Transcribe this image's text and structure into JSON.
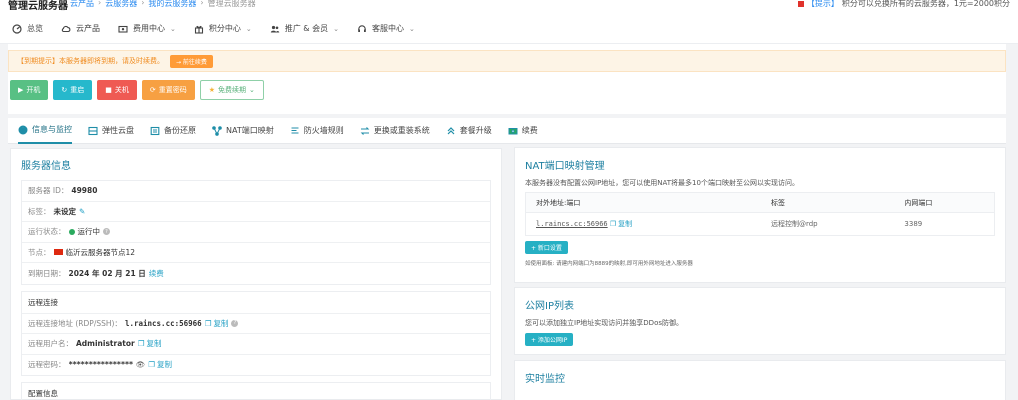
{
  "topbar": {
    "title": "管理云服务器",
    "breadcrumbs": [
      "云产品",
      "云服务器",
      "我的云服务器",
      "管理云服务器"
    ],
    "notice_prefix": "【提示】",
    "notice_text": "积分可以兑换所有的云服务器，1元=2000积分"
  },
  "nav": {
    "items": [
      {
        "label": "总览",
        "icon": "dashboard-icon",
        "chevron": false
      },
      {
        "label": "云产品",
        "icon": "cloud-icon",
        "chevron": false
      },
      {
        "label": "费用中心",
        "icon": "money-icon",
        "chevron": true
      },
      {
        "label": "积分中心",
        "icon": "gift-icon",
        "chevron": true
      },
      {
        "label": "推广 & 会员",
        "icon": "users-icon",
        "chevron": true
      },
      {
        "label": "客服中心",
        "icon": "headset-icon",
        "chevron": true
      }
    ]
  },
  "alert": {
    "text": "【到期提示】本服务器即将到期，请及时续费。",
    "renew_label": "→ 前往续费"
  },
  "actions": {
    "start": "开机",
    "restart": "重启",
    "shutdown": "关机",
    "reset_password": "重置密码",
    "free_renew": "免费续期"
  },
  "tabs": [
    {
      "label": "信息与监控",
      "icon": "info-icon",
      "active": true
    },
    {
      "label": "弹性云盘",
      "icon": "disk-icon",
      "active": false
    },
    {
      "label": "备份还原",
      "icon": "backup-icon",
      "active": false
    },
    {
      "label": "NAT端口映射",
      "icon": "network-icon",
      "active": false
    },
    {
      "label": "防火墙规则",
      "icon": "firewall-icon",
      "active": false
    },
    {
      "label": "更换或重装系统",
      "icon": "swap-icon",
      "active": false
    },
    {
      "label": "套餐升级",
      "icon": "upgrade-icon",
      "active": false
    },
    {
      "label": "续费",
      "icon": "renew-icon",
      "active": false
    }
  ],
  "server_info": {
    "title": "服务器信息",
    "id_label": "服务器 ID：",
    "id_value": "49980",
    "tag_label": "标签：",
    "tag_value": "未设定",
    "status_label": "运行状态：",
    "status_value": "运行中",
    "node_label": "节点：",
    "node_value": "临沂云服务器节点12",
    "expiry_label": "到期日期：",
    "expiry_value": "2024 年 02 月 21 日",
    "expiry_renew": "续费"
  },
  "remote": {
    "title": "远程连接",
    "addr_label": "远程连接地址 (RDP/SSH)：",
    "addr_value": "l.raincs.cc:56966",
    "user_label": "远程用户名：",
    "user_value": "Administrator",
    "pwd_label": "远程密码：",
    "pwd_value": "****************",
    "copy_label": "复制"
  },
  "config": {
    "title": "配置信息"
  },
  "nat": {
    "title": "NAT端口映射管理",
    "desc": "本服务器没有配置公网IP地址，您可以使用NAT将最多10个端口映射至公网以实现访问。",
    "headers": [
      "对外地址:端口",
      "标签",
      "内网端口"
    ],
    "rows": [
      {
        "addr": "l.raincs.cc:56966",
        "copy": "复制",
        "tag": "远程控制@rdp",
        "port": "3389"
      }
    ],
    "add_label": "+ 新口设置",
    "hint": "如使用面板: 请建内网端口为8889的映射,即可用外网地址进入服务器"
  },
  "public_ip": {
    "title": "公网IP列表",
    "desc": "您可以添加独立IP地址实现访问并独享DDos防御。",
    "add_label": "+ 添加公网IP"
  },
  "monitor": {
    "title": "实时监控"
  }
}
